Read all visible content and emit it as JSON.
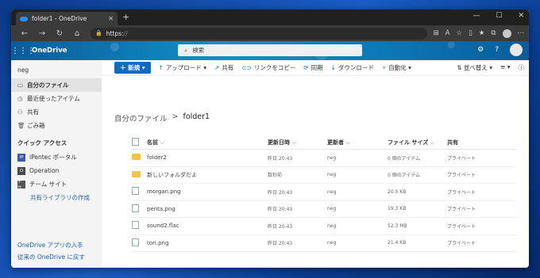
{
  "browser": {
    "tab_title": "folder1 - OneDrive",
    "tab_close": "✕",
    "new_tab": "+",
    "url": "https:",
    "url_rest": "//",
    "window_controls": [
      "—",
      "☐",
      "✕"
    ]
  },
  "header": {
    "brand": "OneDrive",
    "search_placeholder": "検索"
  },
  "sidebar": {
    "user": "neg",
    "items": [
      {
        "label": "自分のファイル",
        "icon": "folder-icon"
      },
      {
        "label": "最近使ったアイテム",
        "icon": "clock-icon"
      },
      {
        "label": "共有",
        "icon": "share-icon"
      },
      {
        "label": "ごみ箱",
        "icon": "trash-icon"
      }
    ],
    "quick_access_heading": "クイック アクセス",
    "libraries": [
      {
        "label": "iPentec ポータル",
        "badge": "iP",
        "color": "#3a5aa8"
      },
      {
        "label": "Operation",
        "badge": "O",
        "color": "#4a4a4a"
      },
      {
        "label": "チーム サイト",
        "badge": "チサ",
        "color": "#555555"
      }
    ],
    "create_shared_library": "共有ライブラリの作成",
    "get_apps": "OneDrive アプリの入手",
    "return_classic": "従来の OneDrive に戻す"
  },
  "commands": {
    "new": "新規",
    "upload": "アップロード",
    "share": "共有",
    "copy_link": "リンクをコピー",
    "sync": "同期",
    "download": "ダウンロード",
    "automate": "自動化",
    "sort": "並べ替え"
  },
  "breadcrumb": {
    "root": "自分のファイル",
    "separator": ">",
    "current": "folder1"
  },
  "table": {
    "headers": {
      "name": "名前",
      "modified": "更新日時",
      "modified_by": "更新者",
      "size": "ファイル サイズ",
      "sharing": "共有"
    },
    "rows": [
      {
        "type": "folder",
        "name": "folder2",
        "modified": "昨日 20:43",
        "by": "neg",
        "size": "0 個のアイテム",
        "sharing": "プライベート"
      },
      {
        "type": "folder",
        "name": "新しいフォルダだよ",
        "modified": "数秒前",
        "by": "neg",
        "size": "0 個のアイテム",
        "sharing": "プライベート"
      },
      {
        "type": "image",
        "name": "morgan.png",
        "modified": "昨日 20:43",
        "by": "neg",
        "size": "20.5 KB",
        "sharing": "プライベート"
      },
      {
        "type": "image",
        "name": "penta.png",
        "modified": "昨日 20:43",
        "by": "neg",
        "size": "19.3 KB",
        "sharing": "プライベート"
      },
      {
        "type": "audio",
        "name": "sound2.flac",
        "modified": "昨日 20:43",
        "by": "neg",
        "size": "52.3 MB",
        "sharing": "プライベート"
      },
      {
        "type": "image",
        "name": "tori.png",
        "modified": "昨日 20:43",
        "by": "neg",
        "size": "21.4 KB",
        "sharing": "プライベート"
      }
    ]
  }
}
